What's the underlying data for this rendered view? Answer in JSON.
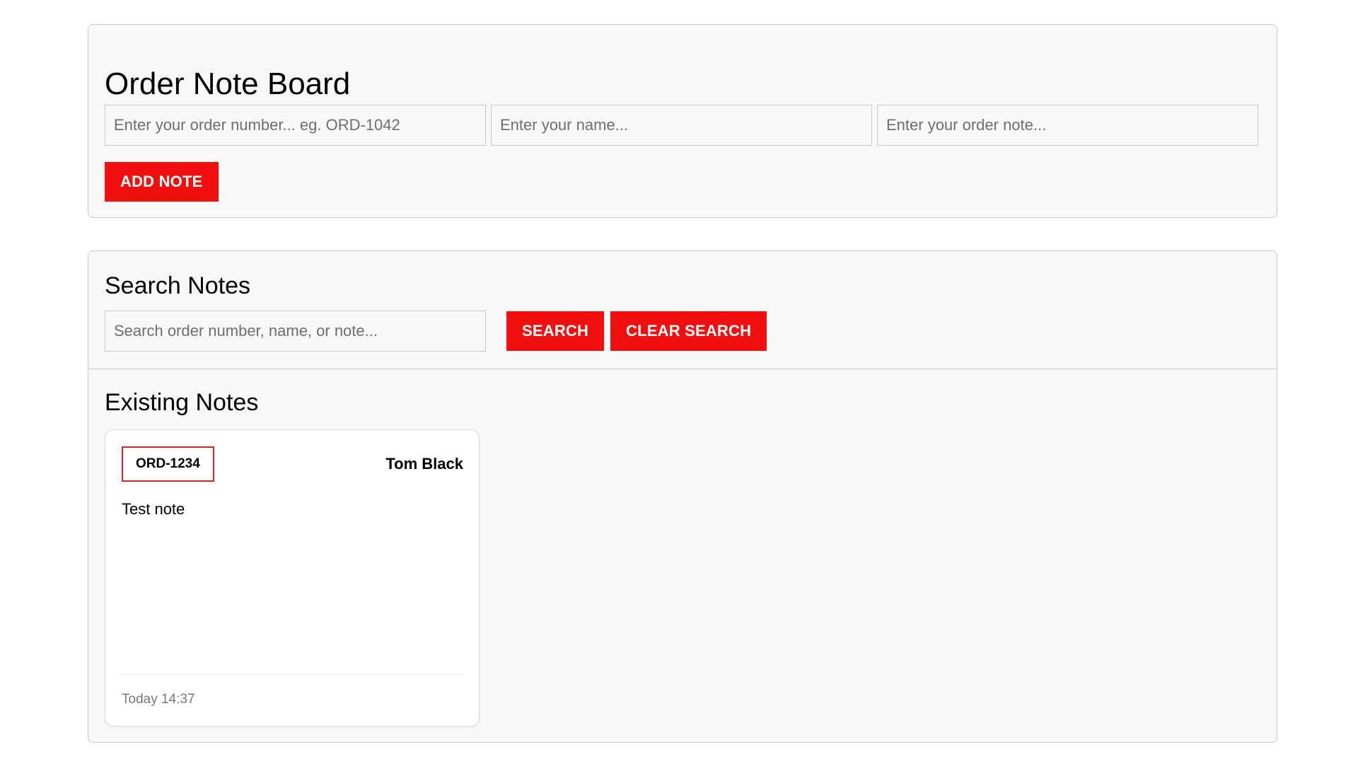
{
  "header": {
    "title": "Order Note Board"
  },
  "add_form": {
    "order_number_placeholder": "Enter your order number... eg. ORD-1042",
    "name_placeholder": "Enter your name...",
    "note_placeholder": "Enter your order note...",
    "add_button_label": "ADD NOTE"
  },
  "search": {
    "heading": "Search Notes",
    "placeholder": "Search order number, name, or note...",
    "search_button_label": "SEARCH",
    "clear_button_label": "CLEAR SEARCH"
  },
  "notes": {
    "heading": "Existing Notes",
    "items": [
      {
        "order_number": "ORD-1234",
        "author": "Tom Black",
        "text": "Test note",
        "timestamp": "Today 14:37"
      }
    ]
  },
  "colors": {
    "accent": "#f20f0f",
    "panel_background": "#f8f8f8",
    "border": "#c8c8c8",
    "timestamp": "#777777"
  }
}
